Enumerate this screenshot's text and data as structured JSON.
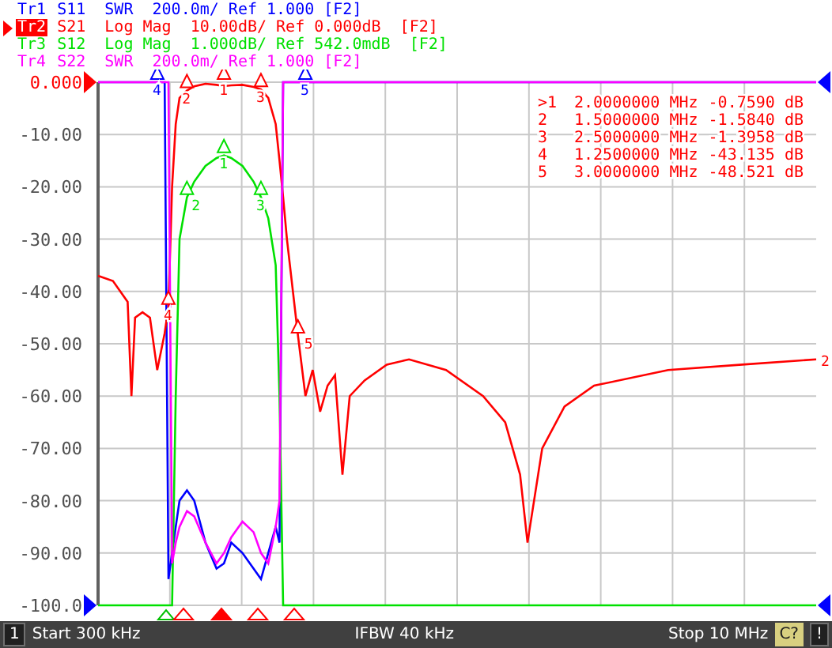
{
  "traces": [
    {
      "name": "Tr1",
      "text": "S11  SWR  200.0m/ Ref 1.000 [F2]",
      "color": "#0000ff",
      "selected": false
    },
    {
      "name": "Tr2",
      "text": "S21  Log Mag  10.00dB/ Ref 0.000dB  [F2]",
      "color": "#ff0000",
      "selected": true
    },
    {
      "name": "Tr3",
      "text": "S12  Log Mag  1.000dB/ Ref 542.0mdB  [F2]",
      "color": "#00e000",
      "selected": false
    },
    {
      "name": "Tr4",
      "text": "S22  SWR  200.0m/ Ref 1.000 [F2]",
      "color": "#ff00ff",
      "selected": false
    }
  ],
  "marker_table": [
    {
      "id": ">1",
      "frequency": "2.0000000 MHz",
      "value": "-0.7590 dB"
    },
    {
      "id": "2",
      "frequency": "1.5000000 MHz",
      "value": "-1.5840 dB"
    },
    {
      "id": "3",
      "frequency": "2.5000000 MHz",
      "value": "-1.3958 dB"
    },
    {
      "id": "4",
      "frequency": "1.2500000 MHz",
      "value": "-43.135 dB"
    },
    {
      "id": "5",
      "frequency": "3.0000000 MHz",
      "value": "-48.521 dB"
    }
  ],
  "y_axis_labels": [
    "0.000",
    "-10.00",
    "-20.00",
    "-30.00",
    "-40.00",
    "-50.00",
    "-60.00",
    "-70.00",
    "-80.00",
    "-90.00",
    "-100.0"
  ],
  "trace_markers": [
    {
      "text": "1",
      "color": "#ff0000"
    },
    {
      "text": "2",
      "color": "#ff0000"
    },
    {
      "text": "3",
      "color": "#ff0000"
    },
    {
      "text": "4",
      "color": "#ff0000"
    },
    {
      "text": "5",
      "color": "#ff0000"
    },
    {
      "text": "1",
      "color": "#00e000"
    },
    {
      "text": "2",
      "color": "#00e000"
    },
    {
      "text": "3",
      "color": "#00e000"
    },
    {
      "text": "4",
      "color": "#0000ff"
    },
    {
      "text": "5",
      "color": "#0000ff"
    }
  ],
  "trace_end_label": {
    "text": "2",
    "color": "#ff0000"
  },
  "status_bar": {
    "channel": "1",
    "start": "Start 300 kHz",
    "ifbw": "IFBW 40 kHz",
    "stop": "Stop 10 MHz",
    "calibration": "C?",
    "alert": "!"
  }
}
